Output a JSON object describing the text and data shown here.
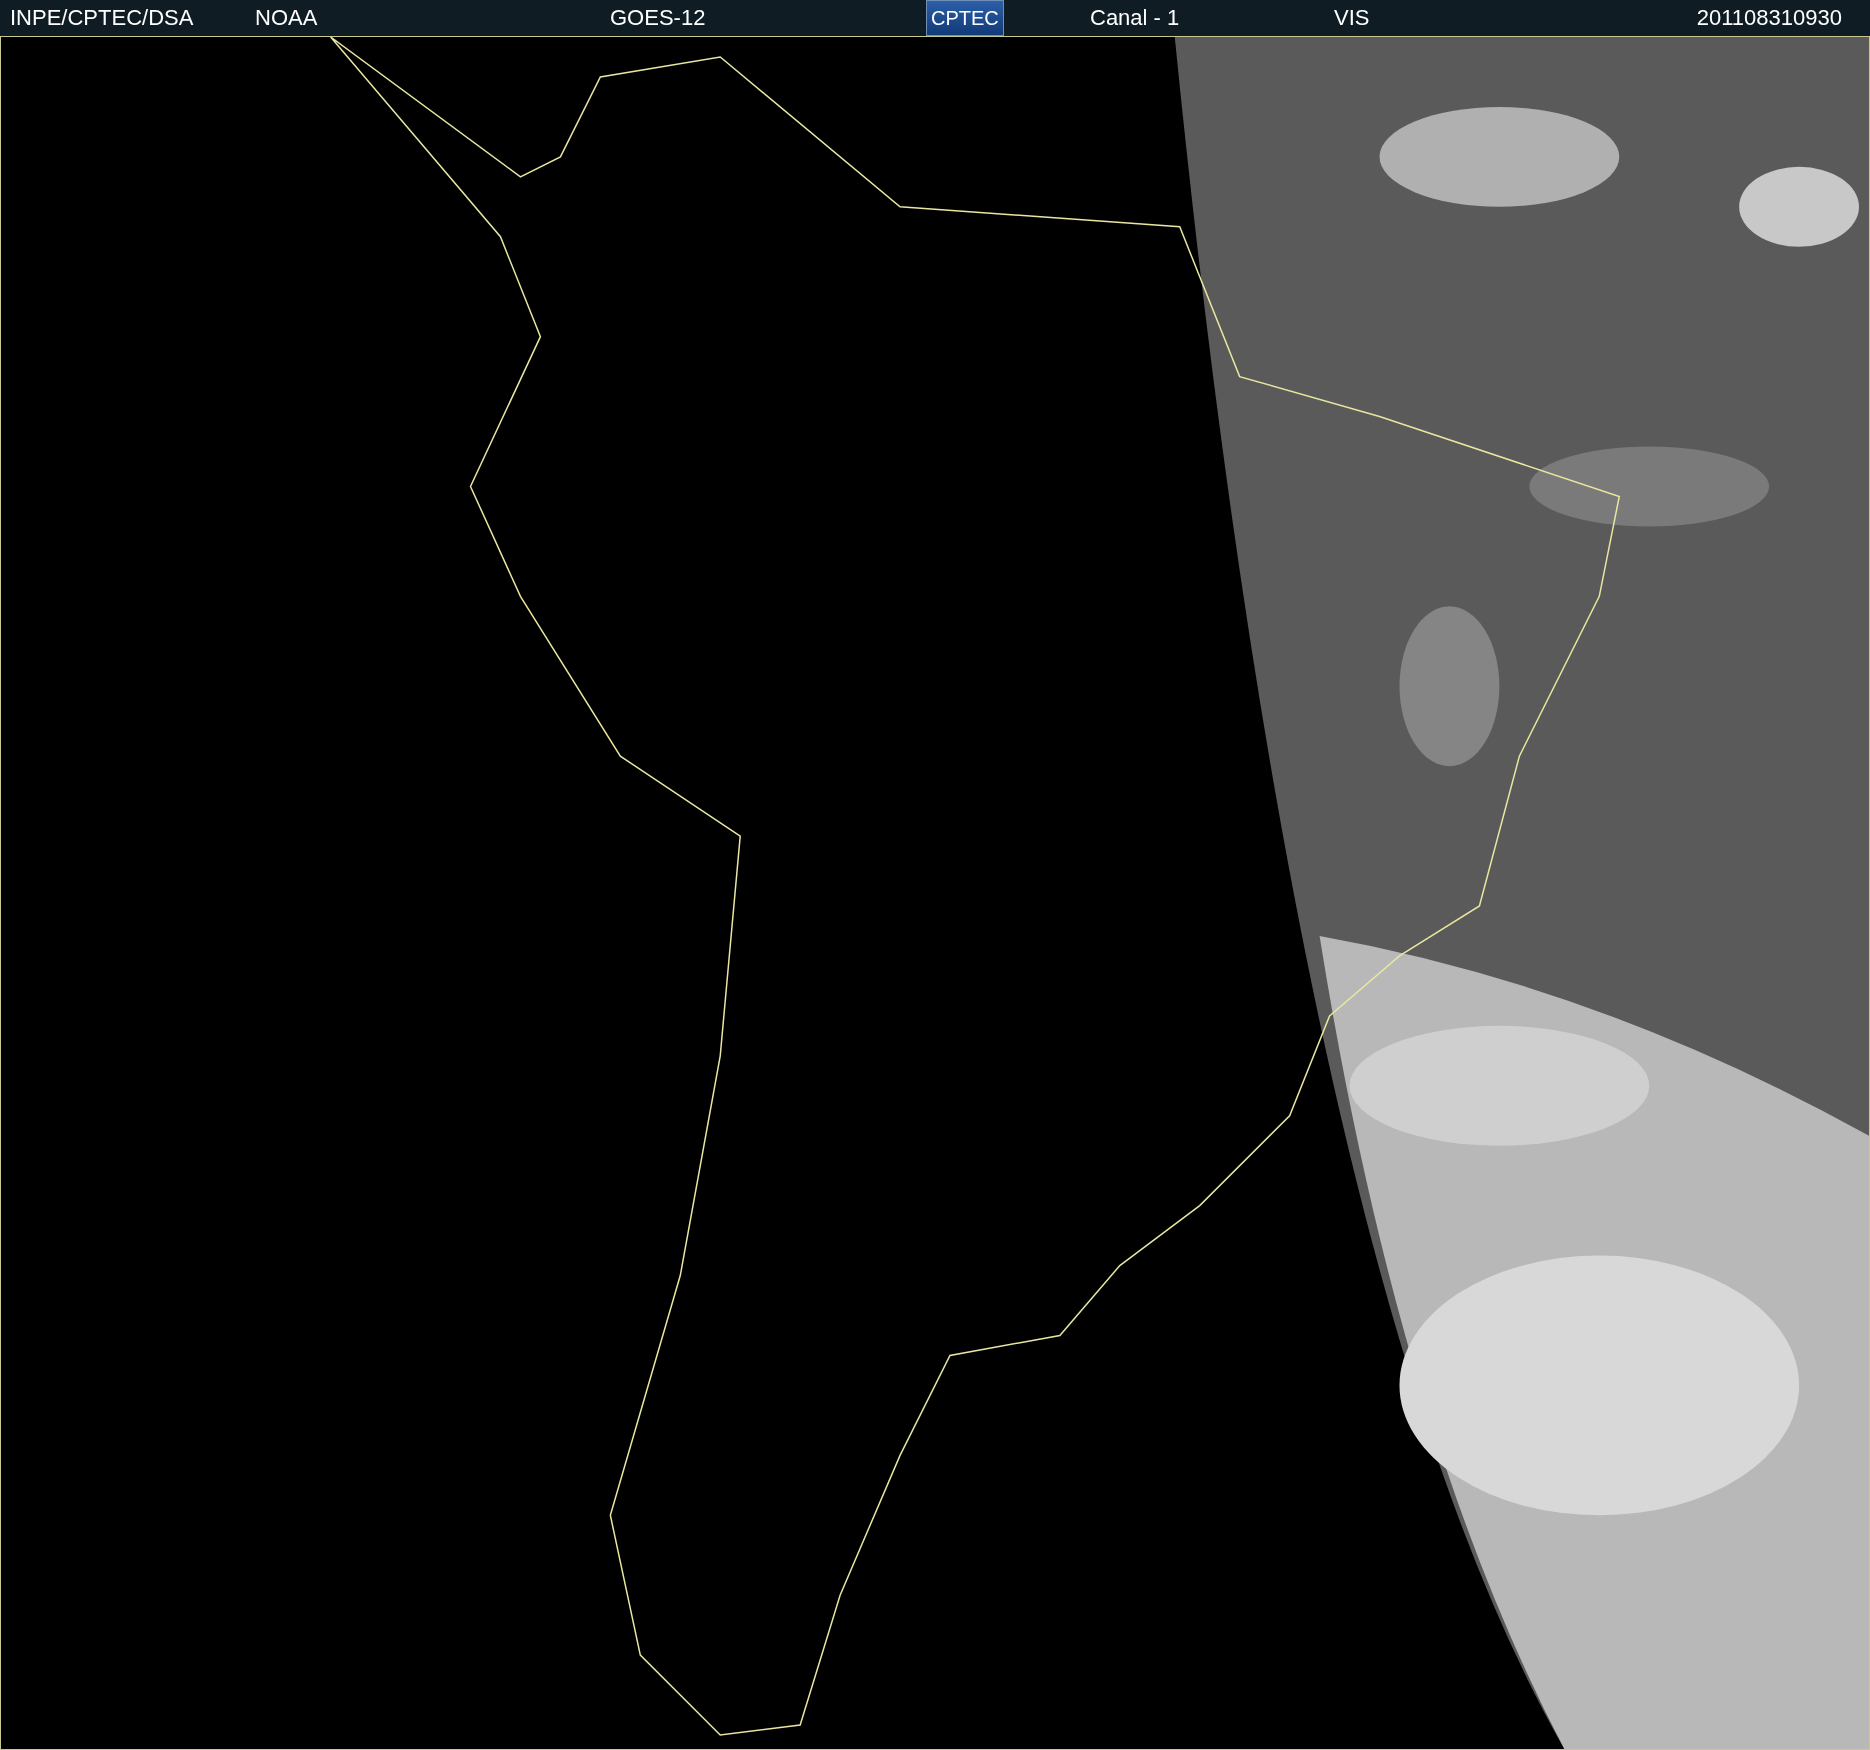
{
  "header": {
    "items": [
      {
        "kind": "text",
        "text": "INPE/CPTEC/DSA"
      },
      {
        "kind": "text",
        "text": "NOAA"
      },
      {
        "kind": "text",
        "text": "GOES-12"
      },
      {
        "kind": "logo",
        "text": "CPTEC"
      },
      {
        "kind": "text",
        "text": "Canal - 1"
      },
      {
        "kind": "text",
        "text": "VIS"
      },
      {
        "kind": "text",
        "text": "201108310930"
      }
    ]
  }
}
